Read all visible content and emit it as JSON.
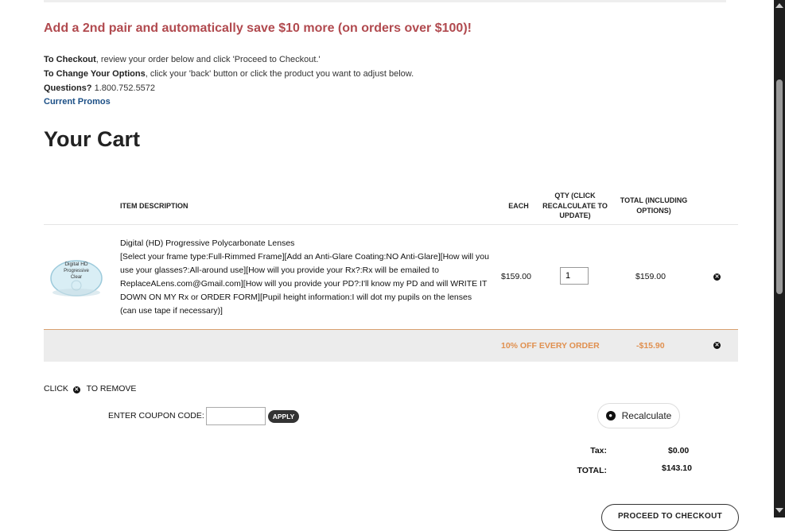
{
  "promo_banner": "Add a 2nd pair and automatically save $10 more (on orders over $100)!",
  "info": {
    "checkout_label": "To Checkout",
    "checkout_text": ", review your order below and click 'Proceed to Checkout.'",
    "change_label": "To Change Your Options",
    "change_text": ", click your 'back' button or click the product you want to adjust below.",
    "questions_label": "Questions?",
    "questions_phone": " 1.800.752.5572",
    "promos_link": "Current Promos"
  },
  "page_title": "Your Cart",
  "table_headers": {
    "item": "ITEM  DESCRIPTION",
    "each": "EACH",
    "qty": "QTY (CLICK RECALCULATE TO UPDATE)",
    "total": "TOTAL (INCLUDING OPTIONS)"
  },
  "cart_item": {
    "image_text": [
      "Digital HD",
      "Progressive",
      "Clear"
    ],
    "name": "Digital (HD) Progressive Polycarbonate Lenses",
    "options": "[Select your frame type:Full-Rimmed Frame][Add an Anti-Glare Coating:NO Anti-Glare][How will you use your glasses?:All-around use][How will you provide your Rx?:Rx will be emailed to ReplaceALens.com@Gmail.com][How will you provide your PD?:I'll know my PD and will WRITE IT DOWN ON MY Rx or ORDER FORM][Pupil height information:I will dot my pupils on the lenses (can use tape if necessary)]",
    "each": "$159.00",
    "qty": "1",
    "total": "$159.00",
    "remove_icon": "close-circle-icon"
  },
  "discount": {
    "label": "10% OFF EVERY ORDER",
    "amount": "-$15.90"
  },
  "remove_hint": {
    "before": "CLICK",
    "after": "TO REMOVE"
  },
  "coupon": {
    "label": "ENTER COUPON CODE:",
    "value": "",
    "apply": "APPLY"
  },
  "recalculate": "Recalculate",
  "totals": {
    "tax_label": "Tax:",
    "tax_value": "$0.00",
    "total_label": "TOTAL:",
    "total_value": "$143.10"
  },
  "checkout_button": "PROCEED TO CHECKOUT",
  "colors": {
    "promo": "#b14a4f",
    "link": "#1b4f86",
    "discount": "#e0904f"
  }
}
